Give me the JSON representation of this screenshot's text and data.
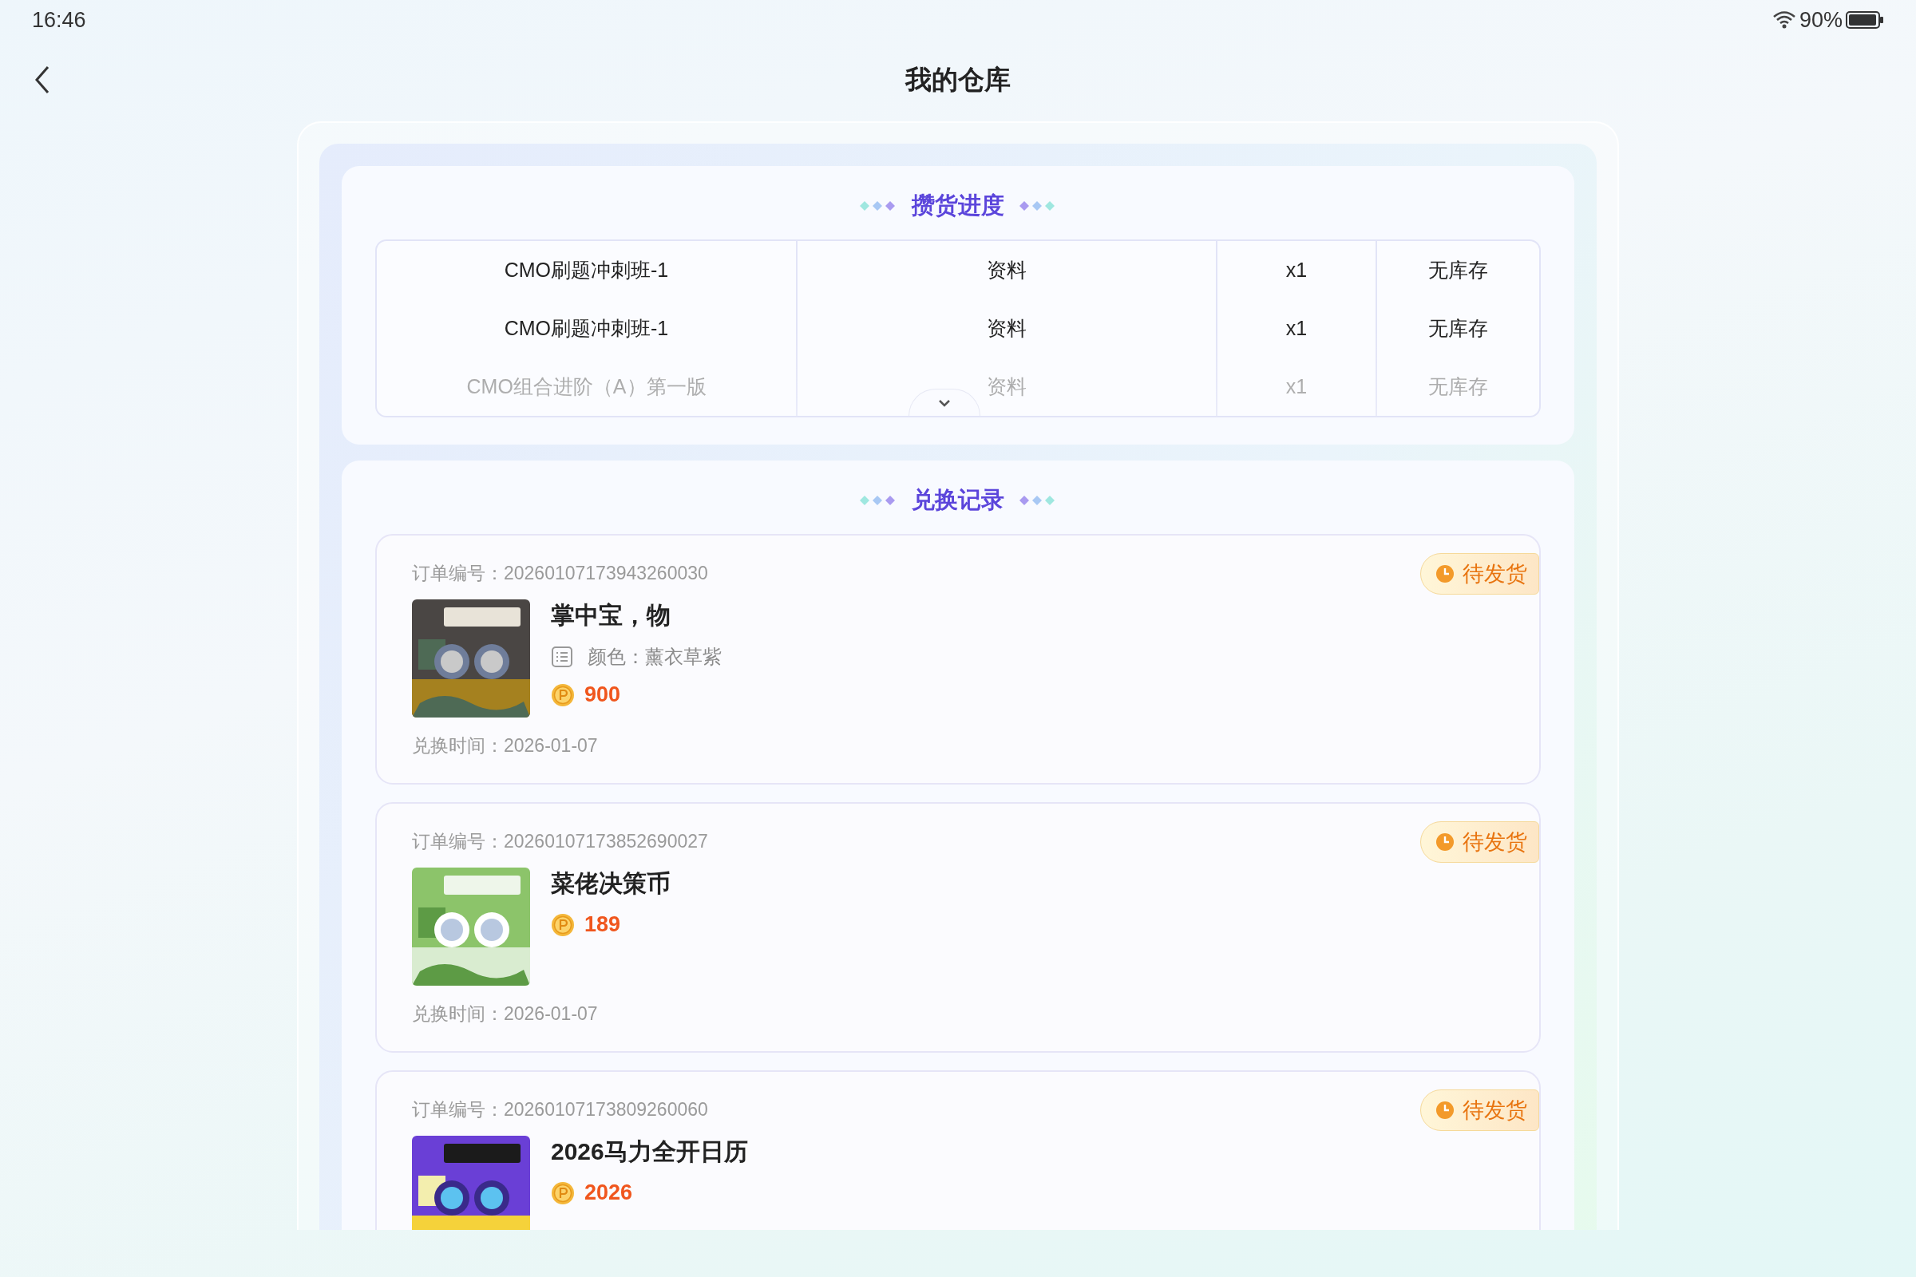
{
  "status_bar": {
    "time": "16:46",
    "battery": "90%"
  },
  "header": {
    "title": "我的仓库"
  },
  "progress": {
    "title": "攒货进度",
    "expanded": false,
    "rows": [
      [
        "CMO刷题冲刺班-1",
        "资料",
        "x1",
        "无库存"
      ],
      [
        "CMO刷题冲刺班-1",
        "资料",
        "x1",
        "无库存"
      ],
      [
        "CMO组合进阶（A）第一版",
        "资料",
        "x1",
        "无库存"
      ]
    ]
  },
  "records": {
    "title": "兑换记录",
    "orders": [
      {
        "order_no": "订单编号：20260107173943260030",
        "status": "待发货",
        "name": "掌中宝，物",
        "spec": "颜色：薰衣草紫",
        "price": "900",
        "exchange_time": "兑换时间：2026-01-07"
      },
      {
        "order_no": "订单编号：20260107173852690027",
        "status": "待发货",
        "name": "菜佬决策币",
        "price": "189",
        "exchange_time": "兑换时间：2026-01-07"
      },
      {
        "order_no": "订单编号：20260107173809260060",
        "status": "待发货",
        "name": "2026马力全开日历",
        "price": "2026"
      }
    ]
  }
}
